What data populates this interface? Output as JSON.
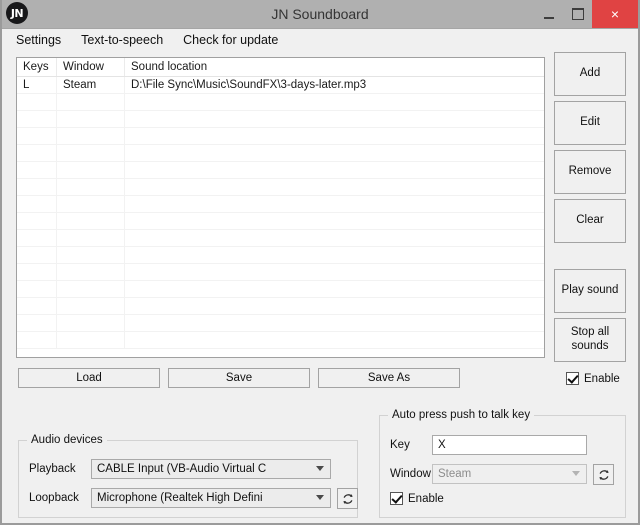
{
  "window": {
    "title": "JN Soundboard",
    "icon_label": "JN",
    "minimize_label": "Minimize",
    "maximize_label": "Maximize",
    "close_label": "×",
    "titlebar_color": "#b0b0b0",
    "close_color": "#e04343"
  },
  "menu": {
    "items": [
      {
        "label": "Settings",
        "name": "menu-settings"
      },
      {
        "label": "Text-to-speech",
        "name": "menu-text-to-speech"
      },
      {
        "label": "Check for update",
        "name": "menu-check-for-update"
      }
    ]
  },
  "list": {
    "columns": [
      "Keys",
      "Window",
      "Sound location"
    ],
    "rows": [
      {
        "keys": "L",
        "window": "Steam",
        "location": "D:\\File Sync\\Music\\SoundFX\\3-days-later.mp3"
      }
    ],
    "empty_row_count": 15
  },
  "side_buttons": {
    "add": "Add",
    "edit": "Edit",
    "remove": "Remove",
    "clear": "Clear",
    "play_sound": "Play sound",
    "stop_all_sounds": "Stop all\nsounds",
    "stop_all_sounds_line1": "Stop all",
    "stop_all_sounds_line2": "sounds",
    "enable_label": "Enable",
    "enable_checked": true
  },
  "file_buttons": {
    "load": "Load",
    "save": "Save",
    "save_as": "Save As"
  },
  "audio_devices": {
    "title": "Audio devices",
    "playback_label": "Playback",
    "playback_value": "CABLE Input (VB-Audio Virtual C",
    "loopback_label": "Loopback",
    "loopback_value": "Microphone (Realtek High Defini",
    "refresh_icon": "refresh-icon"
  },
  "push_to_talk": {
    "title": "Auto press push to talk key",
    "key_label": "Key",
    "key_value": "X",
    "window_label": "Window",
    "window_value": "Steam",
    "window_disabled": true,
    "enable_label": "Enable",
    "enable_checked": true,
    "refresh_icon": "refresh-icon"
  }
}
